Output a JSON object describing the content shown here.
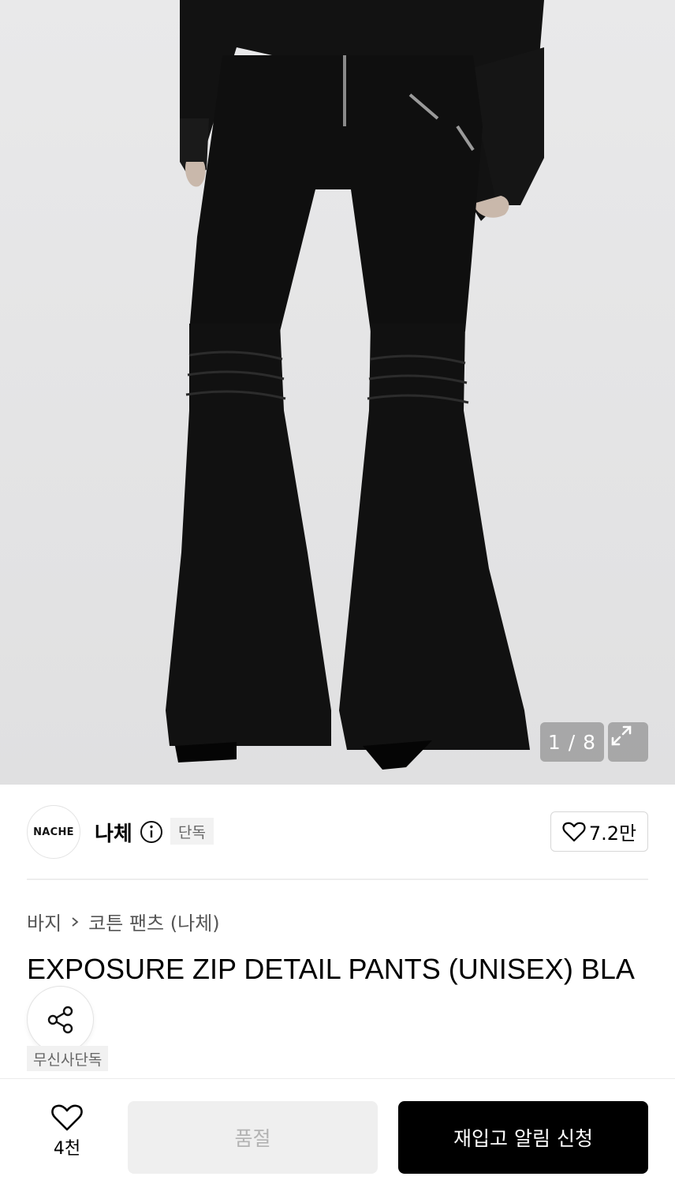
{
  "gallery": {
    "counter": "1 / 8",
    "image_alt": "black flared pants with ruched knees, zip details"
  },
  "brand": {
    "logo_text": "NACHE",
    "name": "나체",
    "badge": "단독",
    "likes": "7.2만"
  },
  "breadcrumb": [
    "바지",
    "코튼 팬츠 (나체)"
  ],
  "product": {
    "title": "EXPOSURE ZIP DETAIL PANTS (UNISEX) BLA",
    "badge": "무신사단독"
  },
  "bottom_bar": {
    "wish_count": "4천",
    "soldout_label": "품절",
    "restock_label": "재입고 알림 신청"
  },
  "icons": [
    "info-icon",
    "heart-icon",
    "share-icon",
    "expand-icon",
    "chevron-right-icon"
  ],
  "colors": {
    "primary": "#000000",
    "soldout_bg": "#efefef",
    "badge_bg": "#f2f2f2"
  }
}
